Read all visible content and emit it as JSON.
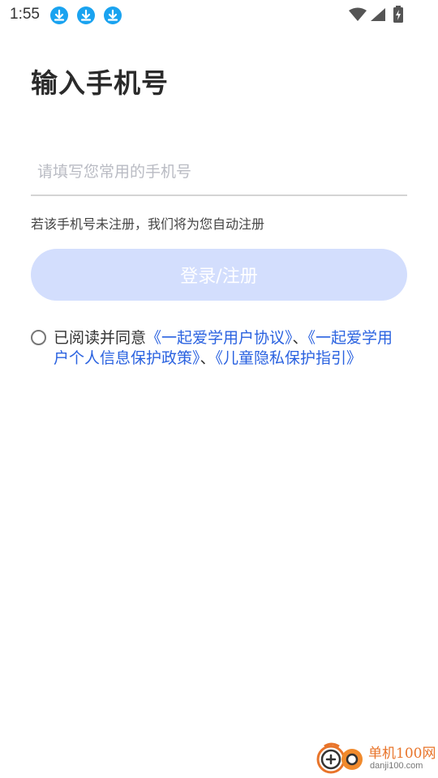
{
  "status_bar": {
    "time": "1:55",
    "notification_icons": [
      "download-icon",
      "download-icon",
      "download-icon"
    ],
    "accent_color": "#1aa3f0"
  },
  "page": {
    "title": "输入手机号"
  },
  "phone_input": {
    "placeholder": "请填写您常用的手机号",
    "value": ""
  },
  "hint": "若该手机号未注册，我们将为您自动注册",
  "login_button": {
    "label": "登录/注册",
    "color": "#d3defd",
    "state": "disabled"
  },
  "agreement": {
    "checked": false,
    "prefix": "已阅读并同意",
    "link1": "《一起爱学用户协议》",
    "sep1": "、",
    "link2": "《一起爱学用户个人信息保护政策》",
    "sep2": "、",
    "link3": "《儿童隐私保护指引》",
    "link_color": "#2a62e0"
  },
  "watermark": {
    "name": "单机100网",
    "domain": "danji100.com"
  }
}
